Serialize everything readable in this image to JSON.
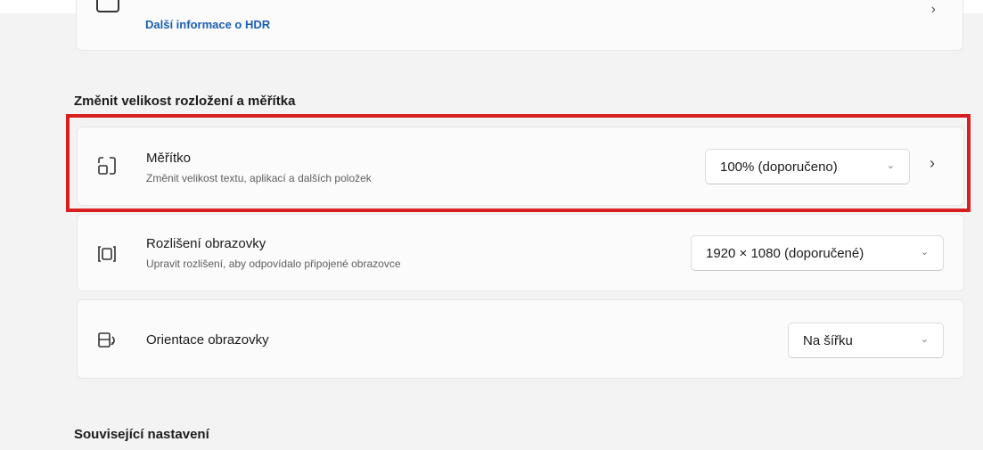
{
  "hdr_card": {
    "link_label": "Další informace o HDR",
    "icon": "monitor-hdr-icon",
    "chevron": "chevron-right-icon"
  },
  "section_layout": {
    "title": "Změnit velikost rozložení a měřítka"
  },
  "scale": {
    "title": "Měřítko",
    "subtitle": "Změnit velikost textu, aplikací a dalších položek",
    "value": "100% (doporučeno)",
    "icon": "scale-icon"
  },
  "resolution": {
    "title": "Rozlišení obrazovky",
    "subtitle": "Upravit rozlišení, aby odpovídalo připojené obrazovce",
    "value": "1920 × 1080 (doporučené)",
    "icon": "resolution-icon"
  },
  "orientation": {
    "title": "Orientace obrazovky",
    "value": "Na šířku",
    "icon": "orientation-icon"
  },
  "section_related": {
    "title": "Související nastavení"
  },
  "colors": {
    "highlight": "#d81e1e",
    "link": "#1a5fb4",
    "background": "#f3f3f3",
    "card": "#fbfbfb"
  }
}
